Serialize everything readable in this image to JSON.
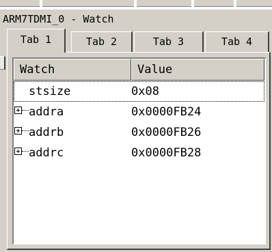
{
  "window": {
    "title": "ARM7TDMI_0 - Watch"
  },
  "tabs": [
    {
      "label": "Tab 1",
      "active": true
    },
    {
      "label": "Tab 2",
      "active": false
    },
    {
      "label": "Tab 3",
      "active": false
    },
    {
      "label": "Tab 4",
      "active": false
    }
  ],
  "watch": {
    "columns": {
      "name": "Watch",
      "value": "Value"
    },
    "rows": [
      {
        "name": "stsize",
        "value": "0x08",
        "expandable": false,
        "selected": true
      },
      {
        "name": "addra",
        "value": "0x0000FB24",
        "expandable": true,
        "selected": false
      },
      {
        "name": "addrb",
        "value": "0x0000FB26",
        "expandable": true,
        "selected": false
      },
      {
        "name": "addrc",
        "value": "0x0000FB28",
        "expandable": true,
        "selected": false
      }
    ]
  },
  "icons": {
    "expand": "plus-box-icon"
  },
  "colors": {
    "face": "#d4d0c8",
    "list_background": "#ffffff",
    "shadow": "#404040"
  }
}
